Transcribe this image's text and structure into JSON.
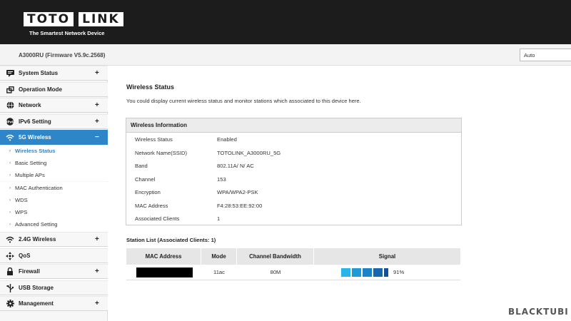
{
  "header": {
    "logo_left": "TOTO",
    "logo_right": "LINK",
    "tagline": "The Smartest Network Device"
  },
  "model_bar": {
    "model": "A3000RU (Firmware V5.9c.2568)",
    "language": "Auto"
  },
  "sidebar": {
    "items": [
      {
        "label": "System Status",
        "sign": "+",
        "icon": "status-icon"
      },
      {
        "label": "Operation Mode",
        "sign": "",
        "icon": "mode-icon"
      },
      {
        "label": "Network",
        "sign": "+",
        "icon": "globe-icon"
      },
      {
        "label": "IPv6 Setting",
        "sign": "+",
        "icon": "ipv6-icon"
      },
      {
        "label": "5G Wireless",
        "sign": "−",
        "icon": "wifi-icon"
      },
      {
        "label": "2.4G Wireless",
        "sign": "+",
        "icon": "wifi-icon"
      },
      {
        "label": "QoS",
        "sign": "",
        "icon": "qos-icon"
      },
      {
        "label": "Firewall",
        "sign": "+",
        "icon": "lock-icon"
      },
      {
        "label": "USB Storage",
        "sign": "",
        "icon": "usb-icon"
      },
      {
        "label": "Management",
        "sign": "+",
        "icon": "gear-icon"
      }
    ],
    "submenu": [
      "Wireless Status",
      "Basic Setting",
      "Multiple APs",
      "MAC Authentication",
      "WDS",
      "WPS",
      "Advanced Setting"
    ]
  },
  "main": {
    "title": "Wireless Status",
    "description": "You could display current wireless status and monitor stations which associated to this device here.",
    "info_header": "Wireless Information",
    "info_rows": [
      {
        "label": "Wireless Status",
        "value": "Enabled"
      },
      {
        "label": "Network Name(SSID)",
        "value": "TOTOLINK_A3000RU_5G"
      },
      {
        "label": "Band",
        "value": "802.11A/ N/ AC"
      },
      {
        "label": "Channel",
        "value": "153"
      },
      {
        "label": "Encryption",
        "value": "WPA/WPA2-PSK"
      },
      {
        "label": "MAC Address",
        "value": "F4:28:53:EE:92:00"
      },
      {
        "label": "Associated Clients",
        "value": "1"
      }
    ],
    "station_title": "Station List (Associated Clients: 1)",
    "station_headers": [
      "MAC Address",
      "Mode",
      "Channel Bandwidth",
      "Signal"
    ],
    "station_rows": [
      {
        "mac": "",
        "mode": "11ac",
        "bandwidth": "80M",
        "signal": "91%",
        "signal_fraction": 0.91
      }
    ],
    "signal_colors": [
      "#29b5e8",
      "#1e9bd7",
      "#1a82c6",
      "#1767b0",
      "#12509a"
    ]
  },
  "watermark": "BLACKTUBI"
}
